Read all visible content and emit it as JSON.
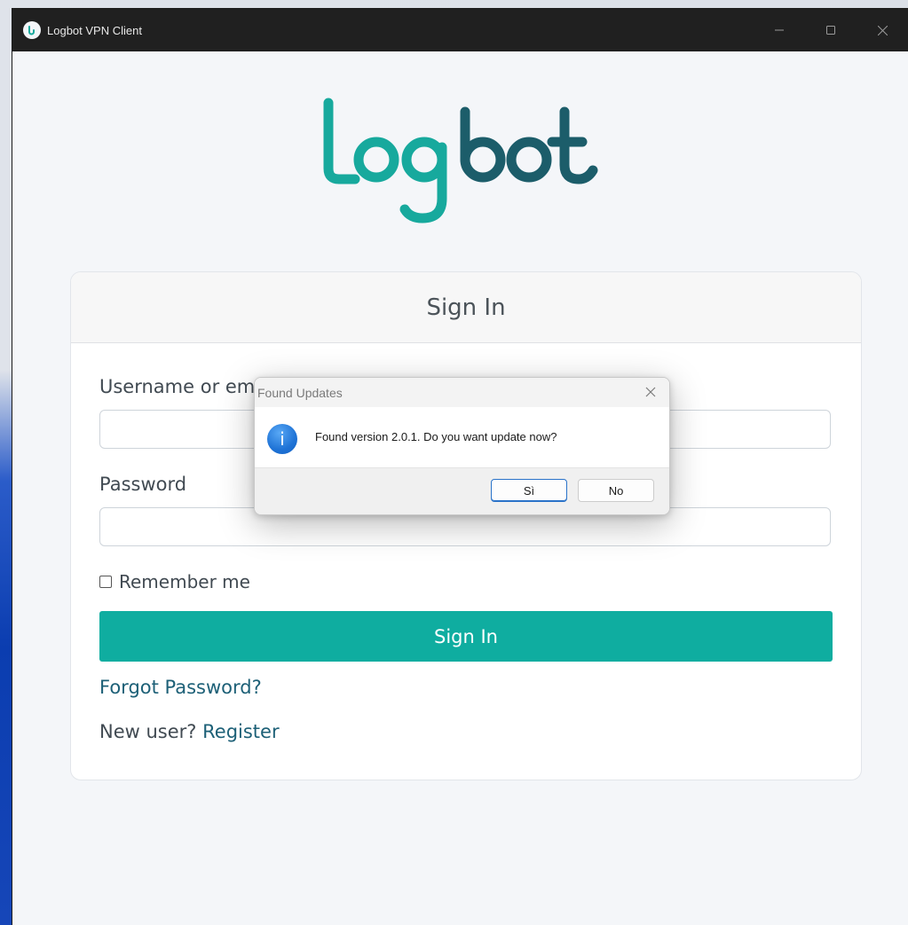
{
  "window": {
    "title": "Logbot VPN Client"
  },
  "logo": {
    "text": "Logbot",
    "colors": {
      "teal": "#17a99d",
      "dark_teal": "#1c5d6a"
    }
  },
  "signin": {
    "header": "Sign In",
    "username_label": "Username or em",
    "username_value": "",
    "password_label": "Password",
    "password_value": "",
    "remember_label": "Remember me",
    "remember_checked": false,
    "submit_label": "Sign In",
    "forgot_label": "Forgot Password?",
    "new_user_text": "New user?",
    "register_label": "Register"
  },
  "dialog": {
    "title": "Found Updates",
    "message": "Found version 2.0.1. Do you want update now?",
    "yes_label": "Sì",
    "no_label": "No",
    "icon": "info-icon"
  },
  "colors": {
    "accent": "#0fada0",
    "link": "#1d6077",
    "titlebar": "#202020",
    "page_bg": "#f4f6f9"
  }
}
